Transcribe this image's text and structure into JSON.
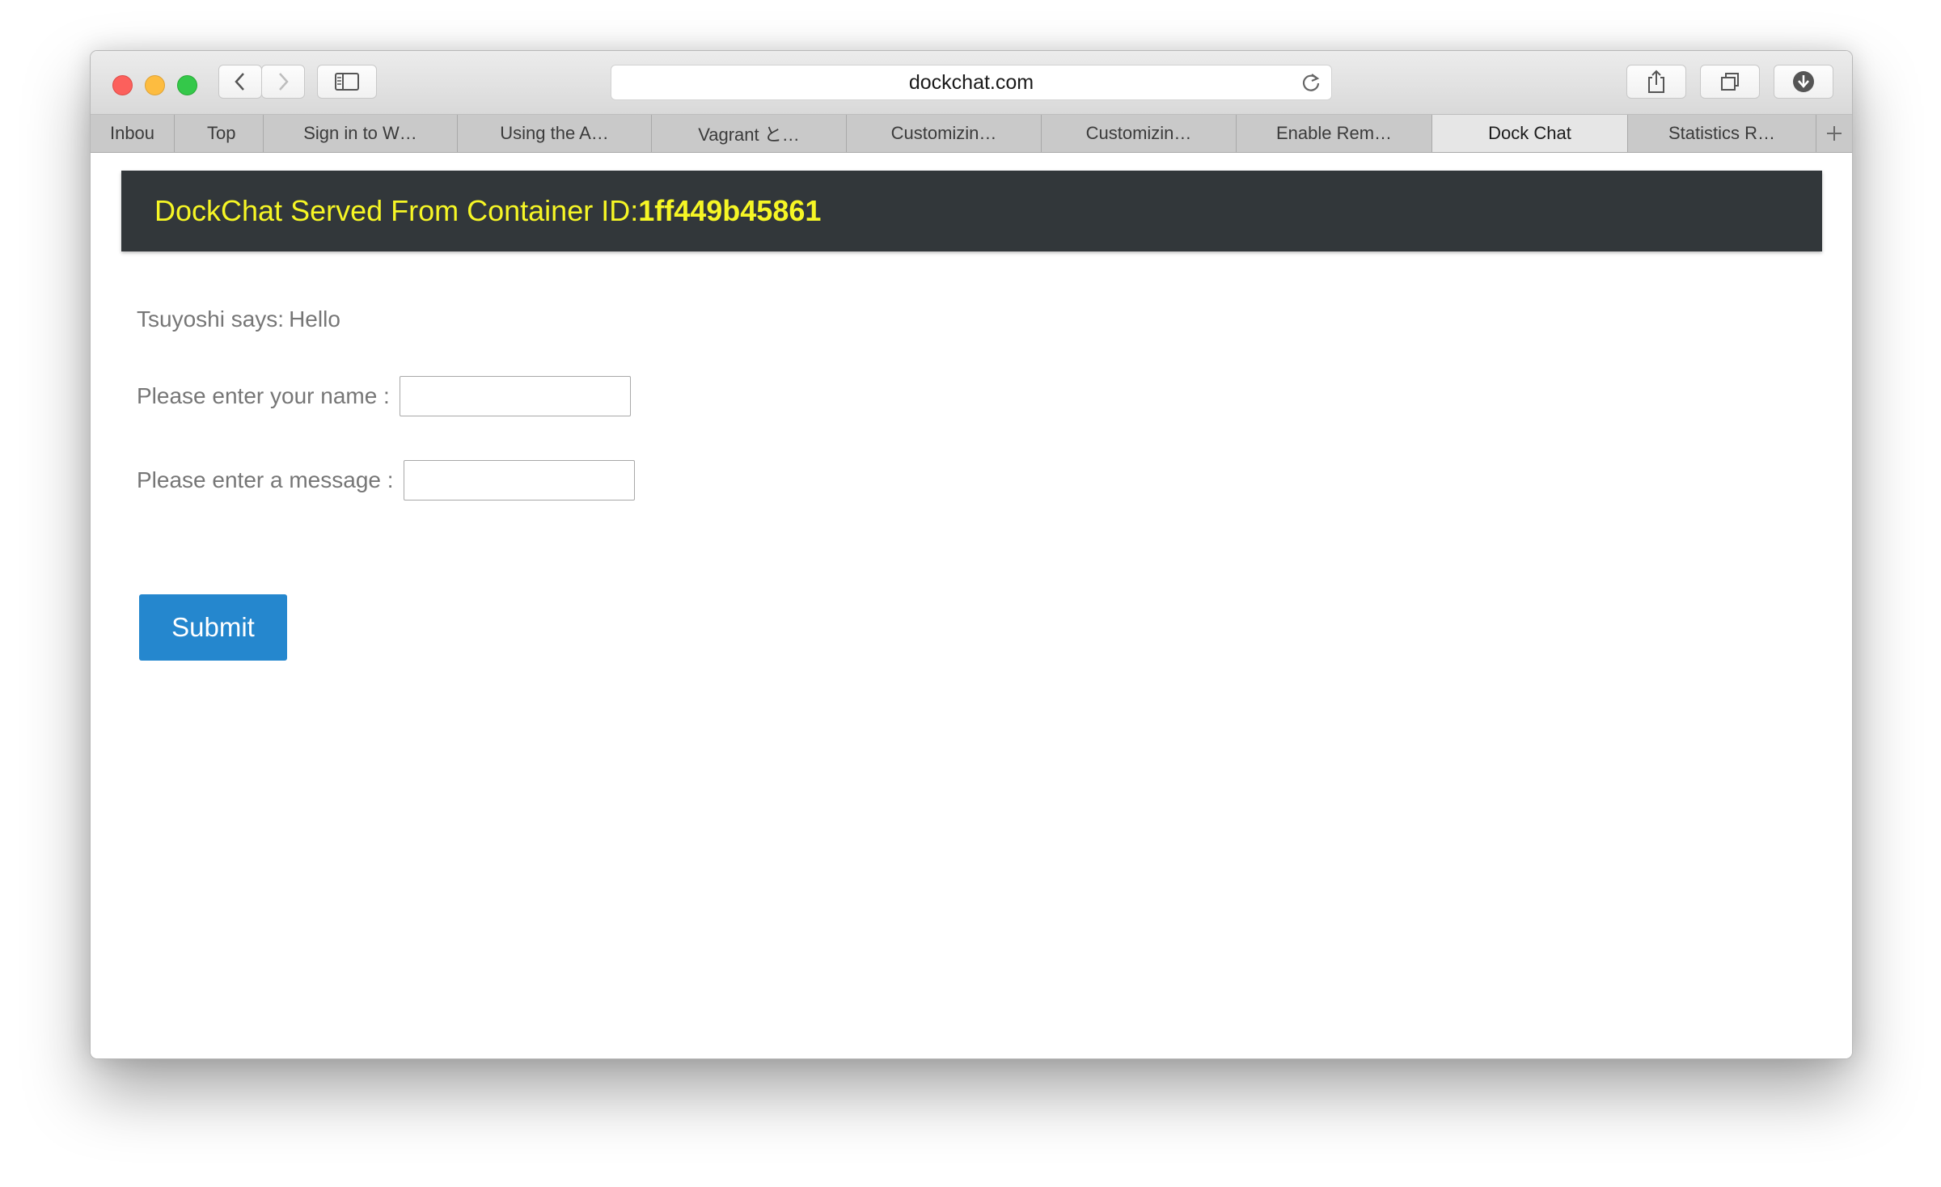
{
  "browser": {
    "url": "dockchat.com",
    "tabs": [
      {
        "label": "Inbou"
      },
      {
        "label": "Top"
      },
      {
        "label": "Sign in to W…"
      },
      {
        "label": "Using the A…"
      },
      {
        "label": "Vagrant と…"
      },
      {
        "label": "Customizin…"
      },
      {
        "label": "Customizin…"
      },
      {
        "label": "Enable Rem…"
      },
      {
        "label": "Dock Chat"
      },
      {
        "label": "Statistics R…"
      }
    ],
    "active_tab": "Dock Chat"
  },
  "page": {
    "banner_prefix": "DockChat Served From Container ID:",
    "container_id": "1ff449b45861",
    "message": {
      "user": "Tsuyoshi",
      "verb": "says:",
      "text": "Hello"
    },
    "name_label": "Please enter your name :",
    "name_value": "",
    "message_label": "Please enter a message :",
    "message_value": "",
    "submit_label": "Submit"
  },
  "colors": {
    "banner_bg": "#32373a",
    "banner_text": "#f6f625",
    "submit_bg": "#2587ce",
    "label_text": "#767676"
  }
}
